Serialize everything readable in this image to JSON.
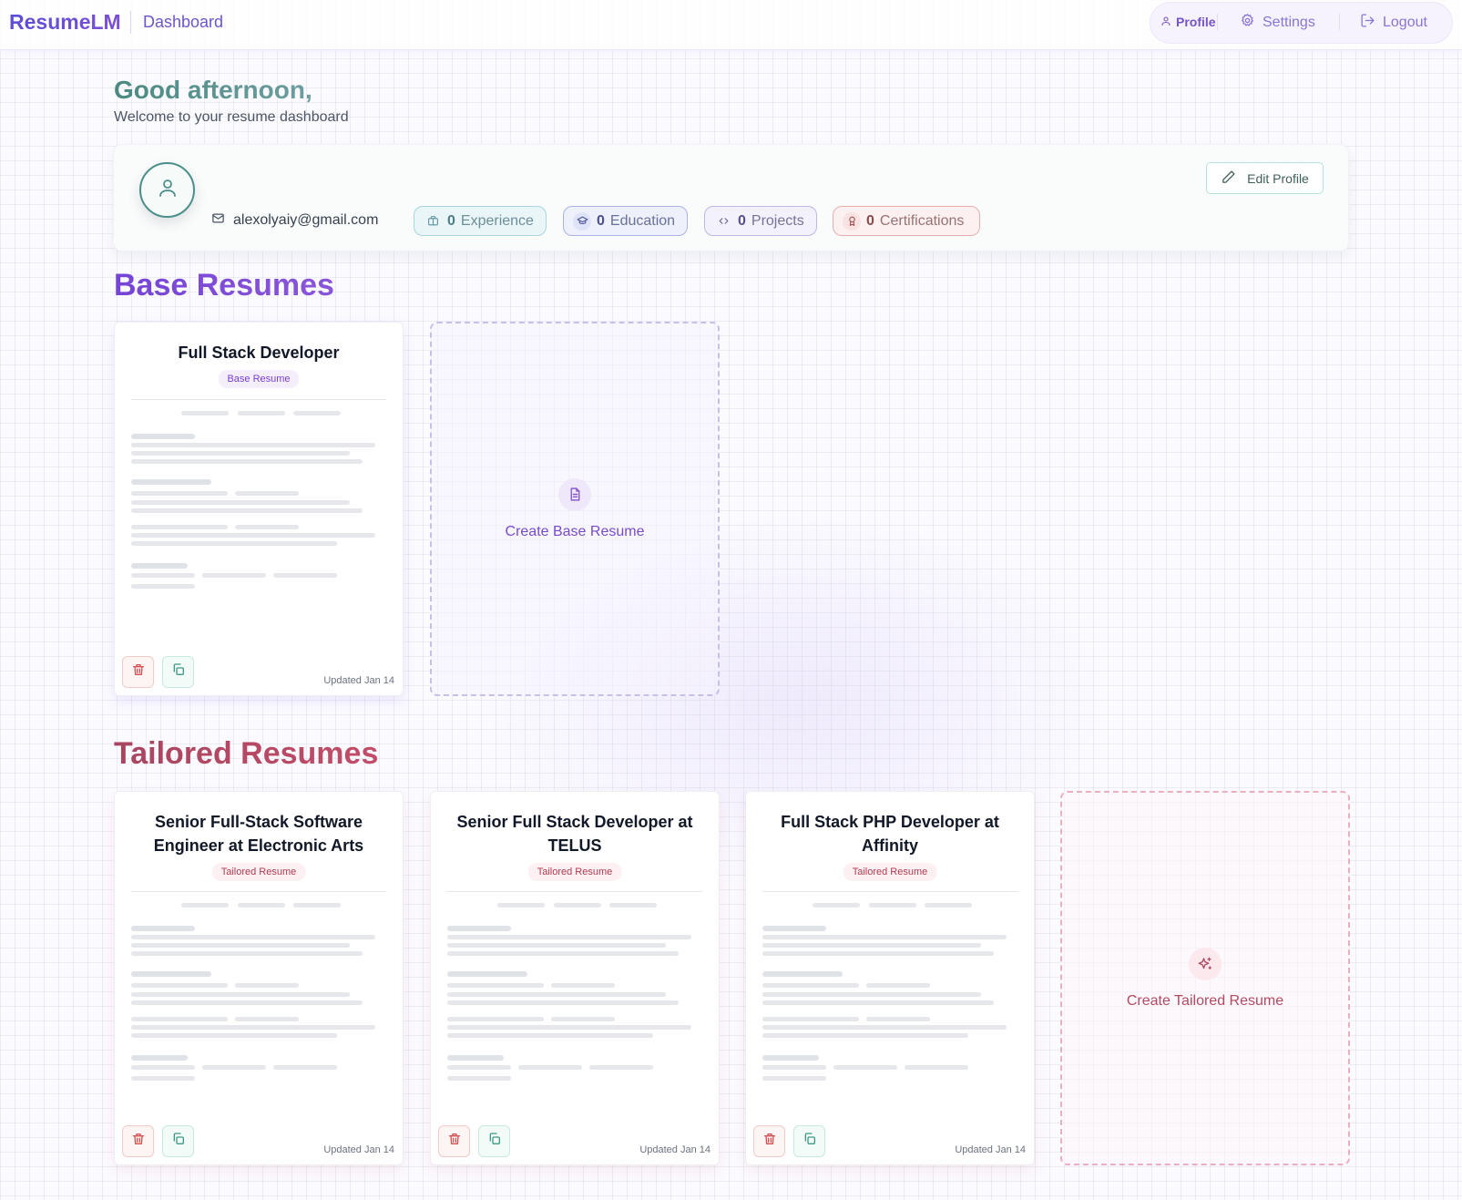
{
  "nav": {
    "brand": "ResumeLM",
    "dashboard": "Dashboard",
    "profile": "Profile",
    "settings": "Settings",
    "logout": "Logout"
  },
  "greeting": {
    "title": "Good afternoon,",
    "subtitle": "Welcome to your resume dashboard"
  },
  "profile": {
    "email": "alexolyaiy@gmail.com",
    "edit_label": "Edit Profile",
    "stats": {
      "experience": {
        "count": "0",
        "label": "Experience"
      },
      "education": {
        "count": "0",
        "label": "Education"
      },
      "projects": {
        "count": "0",
        "label": "Projects"
      },
      "certifications": {
        "count": "0",
        "label": "Certifications"
      }
    }
  },
  "base_section": {
    "title": "Base Resumes",
    "resumes": [
      {
        "title": "Full Stack Developer",
        "tag": "Base Resume",
        "updated": "Updated Jan 14"
      }
    ],
    "create_label": "Create Base Resume"
  },
  "tailored_section": {
    "title": "Tailored Resumes",
    "resumes": [
      {
        "title": "Senior Full-Stack Software Engineer at Electronic Arts",
        "tag": "Tailored Resume",
        "updated": "Updated Jan 14"
      },
      {
        "title": "Senior Full Stack Developer at TELUS",
        "tag": "Tailored Resume",
        "updated": "Updated Jan 14"
      },
      {
        "title": "Full Stack PHP Developer at Affinity",
        "tag": "Tailored Resume",
        "updated": "Updated Jan 14"
      }
    ],
    "create_label": "Create Tailored Resume"
  },
  "colors": {
    "brand": "#5b4fd6",
    "base_accent": "#7544d6",
    "tailored_accent": "#b23b52",
    "greeting": "#4a8a80"
  },
  "icons": {
    "profile": "user-icon",
    "settings": "gear-icon",
    "logout": "logout-icon",
    "email": "mail-icon",
    "experience": "briefcase-icon",
    "education": "graduation-cap-icon",
    "projects": "code-icon",
    "certifications": "award-icon",
    "edit": "pencil-icon",
    "delete": "trash-icon",
    "copy": "copy-icon",
    "create_base": "file-text-icon",
    "create_tailored": "sparkles-icon"
  }
}
